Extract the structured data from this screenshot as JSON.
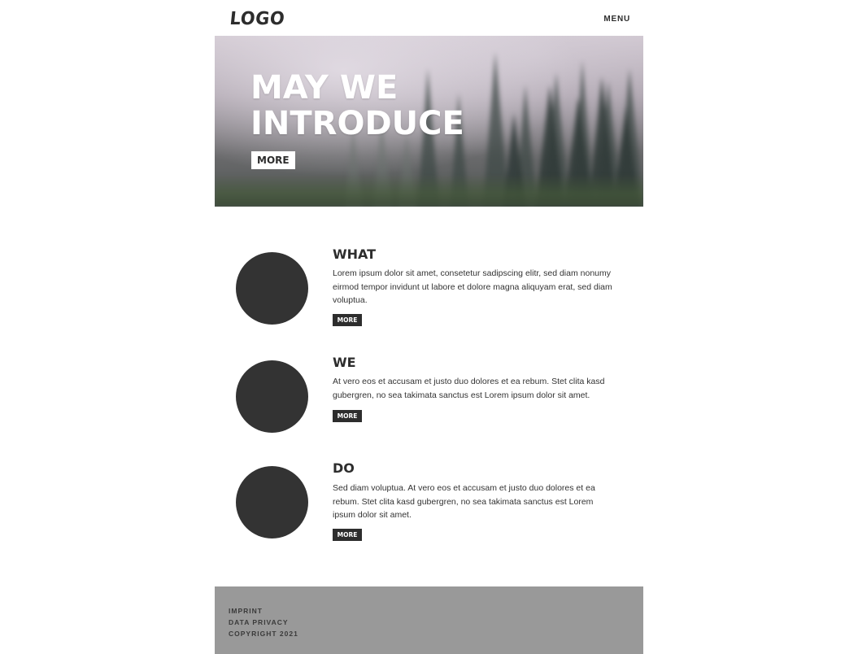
{
  "header": {
    "logo": "LOGO",
    "menu_label": "MENU"
  },
  "hero": {
    "title_lines": [
      "MAY WE",
      "INTRODUCE"
    ],
    "button_label": "MORE"
  },
  "features": [
    {
      "title": "WHAT",
      "text": "Lorem ipsum dolor sit amet, consetetur sadipscing elitr, sed diam nonumy eirmod tempor invidunt ut labore et dolore magna aliquyam erat, sed diam voluptua.",
      "button_label": "MORE"
    },
    {
      "title": "WE",
      "text": "At vero eos et accusam et justo duo dolores et ea rebum. Stet clita kasd gubergren, no sea takimata sanctus est Lorem ipsum dolor sit amet.",
      "button_label": "MORE"
    },
    {
      "title": "DO",
      "text": "Sed diam voluptua. At vero eos et accusam et justo duo dolores et ea rebum. Stet clita kasd gubergren, no sea takimata sanctus est Lorem ipsum dolor sit amet.",
      "button_label": "MORE"
    }
  ],
  "footer": {
    "links": [
      "IMPRINT",
      "DATA PRIVACY",
      "COPYRIGHT 2021"
    ]
  },
  "colors": {
    "dark": "#333333",
    "footer_bg": "#999999",
    "white": "#ffffff"
  }
}
